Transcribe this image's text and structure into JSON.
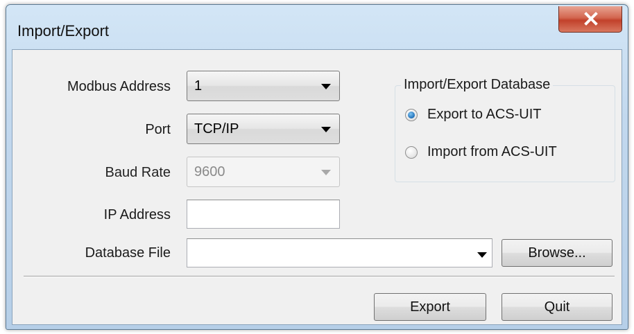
{
  "window": {
    "title": "Import/Export"
  },
  "form": {
    "modbus_address": {
      "label": "Modbus Address",
      "value": "1"
    },
    "port": {
      "label": "Port",
      "value": "TCP/IP"
    },
    "baud_rate": {
      "label": "Baud Rate",
      "value": "9600"
    },
    "ip_address": {
      "label": "IP Address",
      "value": ""
    },
    "database_file": {
      "label": "Database File",
      "value": ""
    }
  },
  "group": {
    "title": "Import/Export Database",
    "options": [
      {
        "label": "Export to ACS-UIT",
        "selected": true
      },
      {
        "label": "Import from ACS-UIT",
        "selected": false
      }
    ]
  },
  "buttons": {
    "browse": "Browse...",
    "export": "Export",
    "quit": "Quit"
  },
  "icons": {
    "close": "close-icon",
    "dropdown": "chevron-down-icon"
  },
  "colors": {
    "title_bar": "#c2d8ee",
    "close_button": "#c2412b",
    "client_bg": "#f0f0f0",
    "radio_selected": "#1f6fb8"
  }
}
